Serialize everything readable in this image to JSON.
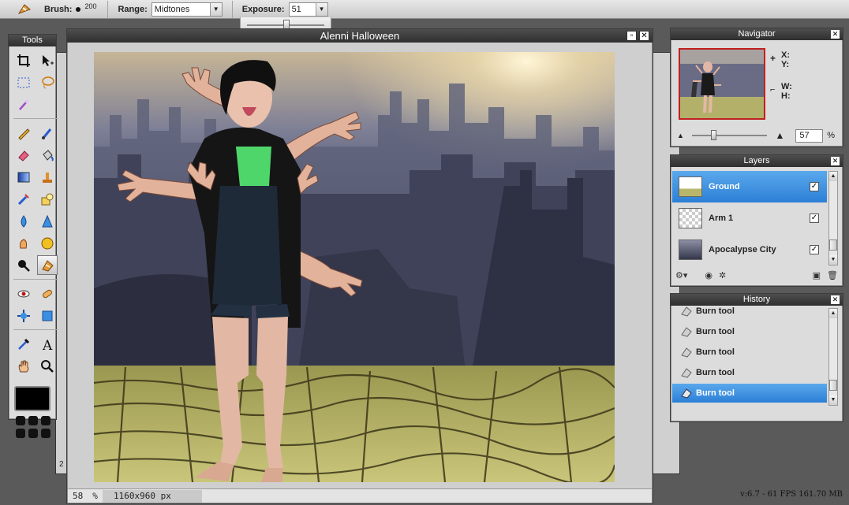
{
  "optionsbar": {
    "brush_label": "Brush:",
    "brush_size": "200",
    "range_label": "Range:",
    "range_value": "Midtones",
    "exposure_label": "Exposure:",
    "exposure_value": "51"
  },
  "tools_panel": {
    "title": "Tools"
  },
  "document": {
    "title": "Alenni Halloween",
    "zoom": "58",
    "zoom_unit": "%",
    "dimensions": "1160x960 px",
    "behind_window_fragment": "2"
  },
  "navigator": {
    "title": "Navigator",
    "x_label": "X:",
    "y_label": "Y:",
    "w_label": "W:",
    "h_label": "H:",
    "zoom_value": "57",
    "zoom_unit": "%"
  },
  "layers": {
    "title": "Layers",
    "items": [
      {
        "name": "Ground",
        "selected": true,
        "visible": true
      },
      {
        "name": "Arm 1",
        "selected": false,
        "visible": true
      },
      {
        "name": "Apocalypse City",
        "selected": false,
        "visible": true
      }
    ]
  },
  "history": {
    "title": "History",
    "items": [
      {
        "label": "Burn tool"
      },
      {
        "label": "Burn tool"
      },
      {
        "label": "Burn tool"
      },
      {
        "label": "Burn tool"
      },
      {
        "label": "Burn tool",
        "selected": true
      }
    ]
  },
  "status": {
    "version": "v:6.7 - 61 FPS 161.70 MB"
  },
  "colors": {
    "selection_blue": "#3a8fe0",
    "panel_title": "#3a3a3a",
    "ground": "#b8b66a"
  }
}
